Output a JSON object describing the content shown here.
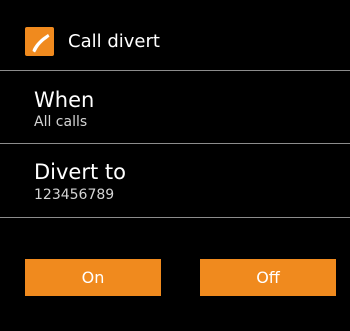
{
  "header": {
    "title": "Call divert",
    "icon": "phone-handset-icon",
    "icon_color": "#f08a1e"
  },
  "settings": [
    {
      "label": "When",
      "value": "All calls"
    },
    {
      "label": "Divert to",
      "value": "123456789"
    }
  ],
  "buttons": {
    "on_label": "On",
    "off_label": "Off",
    "color": "#f08a1e"
  }
}
